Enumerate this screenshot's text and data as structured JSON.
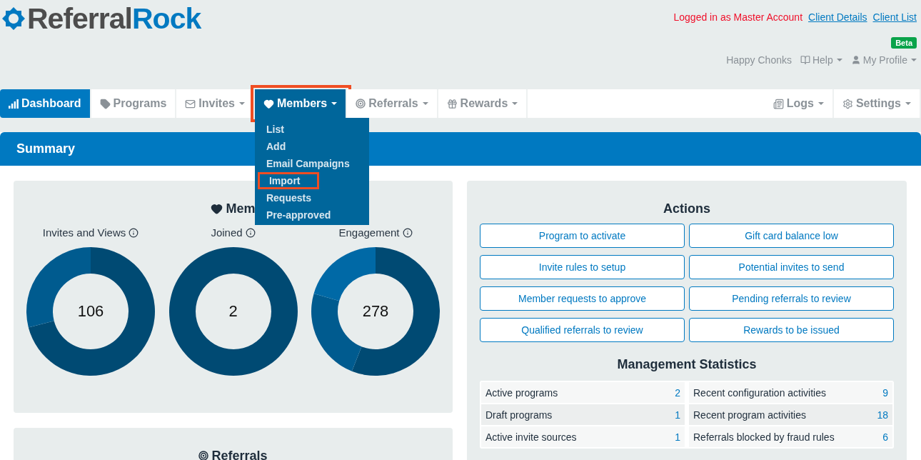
{
  "logo": {
    "first": "Referral",
    "second": "Rock"
  },
  "account": {
    "notice": "Logged in as Master Account",
    "links": [
      "Client Details",
      "Client List"
    ]
  },
  "badge": "Beta",
  "user_menu": [
    {
      "label": "Happy Chonks",
      "caret": false
    },
    {
      "label": "Help",
      "caret": true
    },
    {
      "label": "My Profile",
      "caret": true
    }
  ],
  "nav": {
    "left": [
      {
        "label": "Dashboard",
        "caret": false,
        "selected": true,
        "expanded": false,
        "highlighted": false
      },
      {
        "label": "Programs",
        "caret": false,
        "selected": false,
        "expanded": false,
        "highlighted": false
      },
      {
        "label": "Invites",
        "caret": true,
        "selected": false,
        "expanded": false,
        "highlighted": false
      },
      {
        "label": "Members",
        "caret": true,
        "selected": false,
        "expanded": true,
        "highlighted": true
      },
      {
        "label": "Referrals",
        "caret": true,
        "selected": false,
        "expanded": false,
        "highlighted": false
      },
      {
        "label": "Rewards",
        "caret": true,
        "selected": false,
        "expanded": false,
        "highlighted": false
      }
    ],
    "right": [
      {
        "label": "Logs",
        "caret": true,
        "selected": false,
        "expanded": false,
        "highlighted": false
      },
      {
        "label": "Settings",
        "caret": true,
        "selected": false,
        "expanded": false,
        "highlighted": false
      }
    ]
  },
  "dropdown": [
    {
      "label": "List",
      "highlighted": false
    },
    {
      "label": "Add",
      "highlighted": false
    },
    {
      "label": "Email Campaigns",
      "highlighted": false
    },
    {
      "label": "Import",
      "highlighted": true
    },
    {
      "label": "Requests",
      "highlighted": false
    },
    {
      "label": "Pre-approved",
      "highlighted": false
    }
  ],
  "summary": {
    "title": "Summary"
  },
  "members_panel": {
    "title": "Mem",
    "charts": [
      {
        "label": "Invites and Views",
        "value": "106"
      },
      {
        "label": "Joined",
        "value": "2"
      },
      {
        "label": "Engagement",
        "value": "278"
      }
    ]
  },
  "referrals_panel": {
    "title": "Referrals"
  },
  "actions": {
    "title": "Actions",
    "buttons": [
      "Program to activate",
      "Gift card balance low",
      "Invite rules to setup",
      "Potential invites to send",
      "Member requests to approve",
      "Pending referrals to review",
      "Qualified referrals to review",
      "Rewards to be issued"
    ]
  },
  "management_statistics": {
    "title": "Management Statistics",
    "columns": [
      [
        {
          "label": "Active programs",
          "value": "2"
        },
        {
          "label": "Draft programs",
          "value": "1"
        },
        {
          "label": "Active invite sources",
          "value": "1"
        }
      ],
      [
        {
          "label": "Recent configuration activities",
          "value": "9"
        },
        {
          "label": "Recent program activities",
          "value": "18"
        },
        {
          "label": "Referrals blocked by fraud rules",
          "value": "6"
        }
      ]
    ]
  }
}
